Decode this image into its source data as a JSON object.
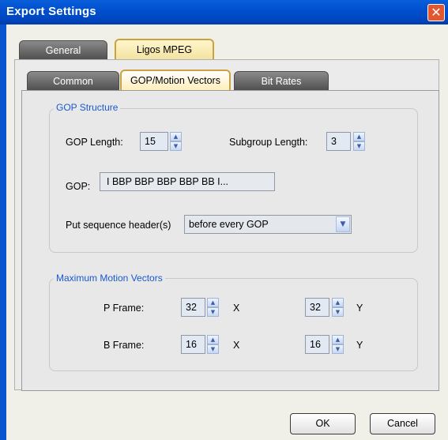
{
  "window": {
    "title": "Export Settings",
    "close_icon": "close-icon"
  },
  "tabs_main": [
    {
      "label": "General",
      "selected": false
    },
    {
      "label": "Ligos MPEG",
      "selected": true
    }
  ],
  "tabs_sub": [
    {
      "label": "Common",
      "selected": false
    },
    {
      "label": "GOP/Motion Vectors",
      "selected": true
    },
    {
      "label": "Bit Rates",
      "selected": false
    }
  ],
  "gop_structure": {
    "title": "GOP Structure",
    "gop_length_label": "GOP Length:",
    "gop_length_value": "15",
    "subgroup_length_label": "Subgroup Length:",
    "subgroup_length_value": "3",
    "gop_label": "GOP:",
    "gop_value": "I BBP BBP BBP BBP BB I...",
    "seq_header_label": "Put sequence header(s)",
    "seq_header_value": "before every GOP"
  },
  "motion_vectors": {
    "title": "Maximum Motion Vectors",
    "p_frame_label": "P Frame:",
    "p_frame_x": "32",
    "p_frame_y": "32",
    "b_frame_label": "B Frame:",
    "b_frame_x": "16",
    "b_frame_y": "16",
    "x_label": "X",
    "y_label": "Y"
  },
  "buttons": {
    "ok": "OK",
    "cancel": "Cancel"
  },
  "colors": {
    "title_bar": "#0054e3",
    "group_title": "#1a58d0",
    "close": "#e2572f"
  }
}
